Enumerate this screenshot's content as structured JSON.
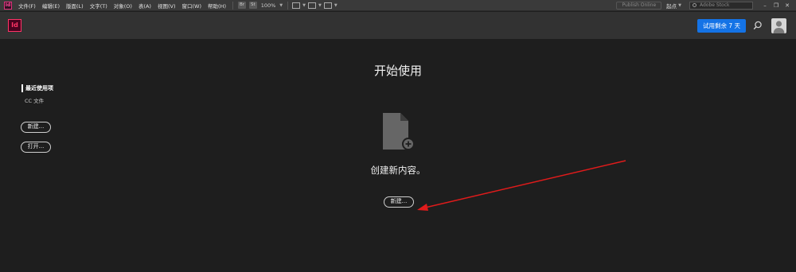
{
  "menubar": {
    "app_badge": "Id",
    "items": [
      "文件(F)",
      "编辑(E)",
      "版面(L)",
      "文字(T)",
      "对象(O)",
      "表(A)",
      "视图(V)",
      "窗口(W)",
      "帮助(H)"
    ],
    "bridge_label": "Br",
    "stock_label": "St",
    "zoom": "100%",
    "publish_label": "Publish Online",
    "workspace": "起点",
    "stock_search_placeholder": "Adobe Stock"
  },
  "header": {
    "logo": "Id",
    "trial_button": "试用剩余 7 天",
    "icons": {
      "search": "search-icon",
      "avatar": "avatar-icon"
    }
  },
  "main": {
    "title": "开始使用",
    "sidebar": {
      "recent": "最近使用项",
      "cc_files": "CC 文件",
      "new_button": "新建...",
      "open_button": "打开..."
    },
    "create_text": "创建新内容。",
    "new_button": "新建..."
  },
  "colors": {
    "accent_blue": "#1473e6",
    "indesign_pink": "#ff3366",
    "annotation_red": "#e01b1b",
    "background": "#1e1e1e"
  }
}
